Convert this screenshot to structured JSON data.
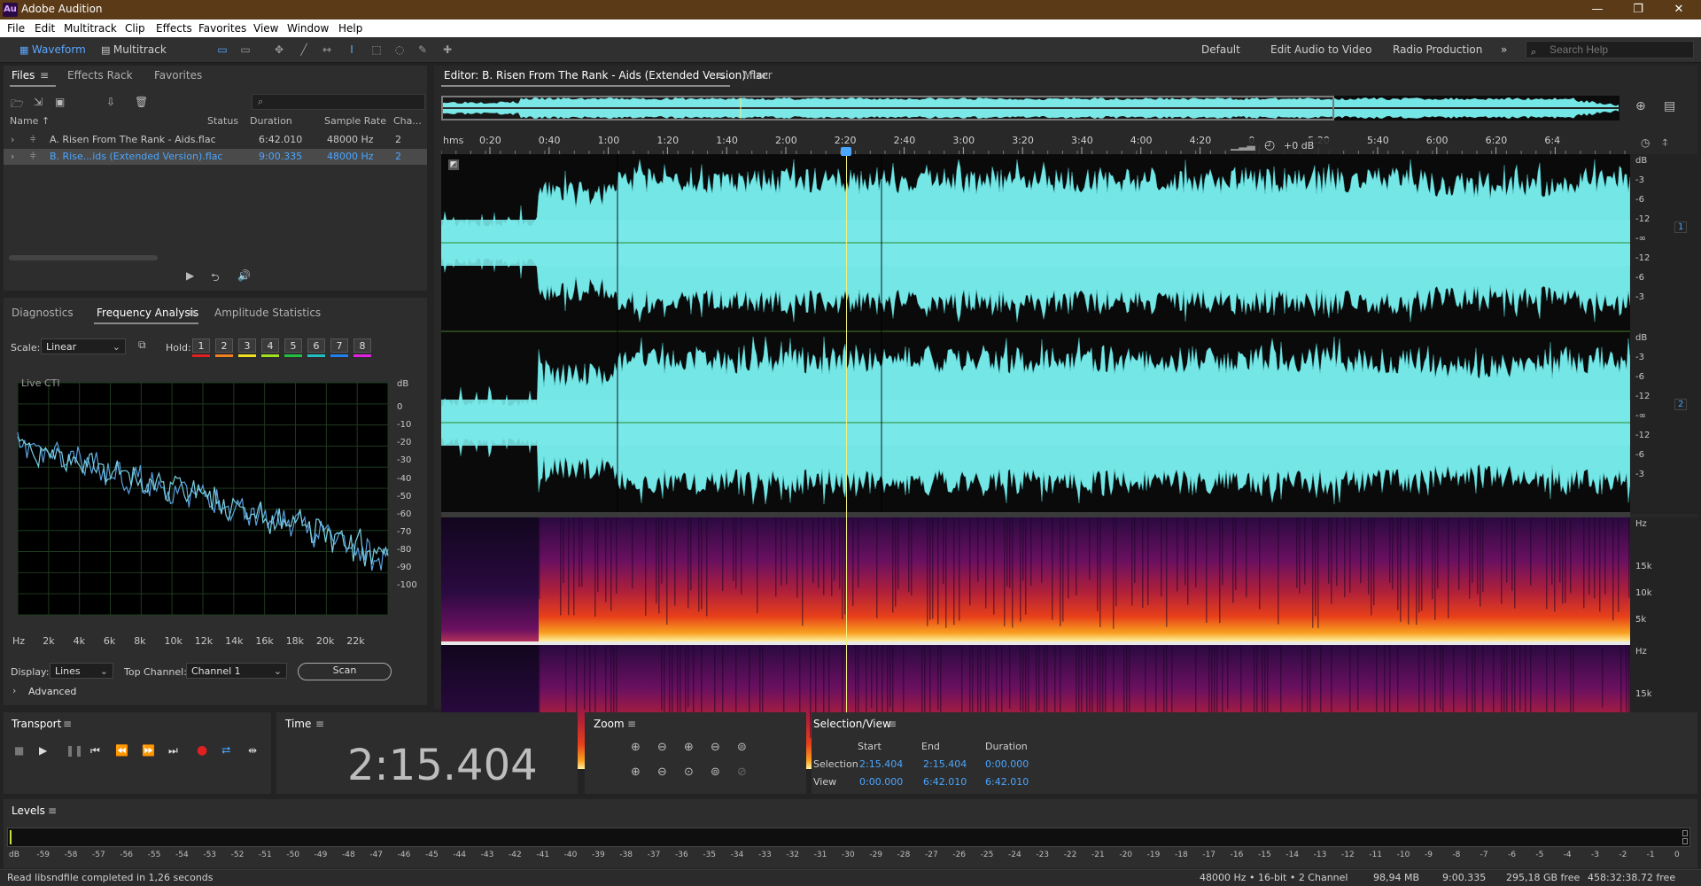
{
  "app": {
    "title": "Adobe Audition",
    "logo": "Au"
  },
  "menu": [
    "File",
    "Edit",
    "Multitrack",
    "Clip",
    "Effects",
    "Favorites",
    "View",
    "Window",
    "Help"
  ],
  "toolbar": {
    "modes": [
      {
        "label": "Waveform",
        "active": true
      },
      {
        "label": "Multitrack",
        "active": false
      }
    ],
    "workspaces": [
      "Default",
      "Edit Audio to Video",
      "Radio Production"
    ],
    "overflow": "»",
    "search_placeholder": "Search Help"
  },
  "files_panel": {
    "tabs": [
      "Files",
      "Effects Rack",
      "Favorites"
    ],
    "search_icon": "⌕",
    "columns": [
      "Name ↑",
      "Status",
      "Duration",
      "Sample Rate",
      "Cha..."
    ],
    "rows": [
      {
        "name": "A. Risen From The Rank - Aids.flac",
        "status": "",
        "duration": "6:42.010",
        "rate": "48000 Hz",
        "ch": "2",
        "selected": false
      },
      {
        "name": "B. Rise...ids (Extended Version).flac",
        "status": "",
        "duration": "9:00.335",
        "rate": "48000 Hz",
        "ch": "2",
        "selected": true
      }
    ]
  },
  "analysis_panel": {
    "tabs": [
      "Diagnostics",
      "Frequency Analysis",
      "Amplitude Statistics"
    ],
    "scale_label": "Scale:",
    "scale_value": "Linear",
    "hold_label": "Hold:",
    "holds": [
      {
        "n": "1",
        "color": "#e02020"
      },
      {
        "n": "2",
        "color": "#f08020"
      },
      {
        "n": "3",
        "color": "#f0e020"
      },
      {
        "n": "4",
        "color": "#a0e020"
      },
      {
        "n": "5",
        "color": "#20c040"
      },
      {
        "n": "6",
        "color": "#20c0c0"
      },
      {
        "n": "7",
        "color": "#2080f0"
      },
      {
        "n": "8",
        "color": "#e020e0"
      }
    ],
    "plot_label": "Live CTI",
    "db_ticks": [
      "dB",
      "0",
      "-10",
      "-20",
      "-30",
      "-40",
      "-50",
      "-60",
      "-70",
      "-80",
      "-90",
      "-100"
    ],
    "freq_ticks": [
      "Hz",
      "2k",
      "4k",
      "6k",
      "8k",
      "10k",
      "12k",
      "14k",
      "16k",
      "18k",
      "20k",
      "22k"
    ],
    "display_label": "Display:",
    "display_value": "Lines",
    "top_channel_label": "Top Channel:",
    "top_channel_value": "Channel 1",
    "scan_label": "Scan",
    "advanced_label": "Advanced"
  },
  "editor": {
    "tab_label": "Editor: B. Risen From The Rank - Aids (Extended Version).flac",
    "mixer_label": "Mixer",
    "ruler_unit": "hms",
    "ruler": [
      "0:20",
      "0:40",
      "1:00",
      "1:20",
      "1:40",
      "2:00",
      "2:20",
      "2:40",
      "3:00",
      "3:20",
      "3:40",
      "4:00",
      "4:20",
      "0",
      "5:20",
      "5:40",
      "6:00",
      "6:20",
      "6:4"
    ],
    "hud_gain": "+0 dB",
    "db_ticks_ch": [
      "dB",
      "-3",
      "-6",
      "-12",
      "-∞",
      "-12",
      "-6",
      "-3"
    ],
    "channels": [
      "1",
      "2"
    ],
    "spec_ticks": [
      "Hz",
      "15k",
      "10k",
      "5k"
    ],
    "colors": {
      "waveform": "#74e6e6",
      "playhead": "#f0f080"
    }
  },
  "transport": {
    "title": "Transport"
  },
  "time_panel": {
    "title": "Time",
    "value": "2:15.404"
  },
  "zoom_panel": {
    "title": "Zoom"
  },
  "selection_view": {
    "title": "Selection/View",
    "headers": [
      "Start",
      "End",
      "Duration"
    ],
    "rows": [
      {
        "label": "Selection",
        "start": "2:15.404",
        "end": "2:15.404",
        "duration": "0:00.000"
      },
      {
        "label": "View",
        "start": "0:00.000",
        "end": "6:42.010",
        "duration": "6:42.010"
      }
    ]
  },
  "levels": {
    "title": "Levels",
    "ticks": [
      "dB",
      "-59",
      "-58",
      "-57",
      "-56",
      "-55",
      "-54",
      "-53",
      "-52",
      "-51",
      "-50",
      "-49",
      "-48",
      "-47",
      "-46",
      "-45",
      "-44",
      "-43",
      "-42",
      "-41",
      "-40",
      "-39",
      "-38",
      "-37",
      "-36",
      "-35",
      "-34",
      "-33",
      "-32",
      "-31",
      "-30",
      "-29",
      "-28",
      "-27",
      "-26",
      "-25",
      "-24",
      "-23",
      "-22",
      "-21",
      "-20",
      "-19",
      "-18",
      "-17",
      "-16",
      "-15",
      "-14",
      "-13",
      "-12",
      "-11",
      "-10",
      "-9",
      "-8",
      "-7",
      "-6",
      "-5",
      "-4",
      "-3",
      "-2",
      "-1",
      "0"
    ]
  },
  "status": {
    "message": "Read libsndfile completed in 1,26 seconds",
    "format": "48000 Hz • 16-bit • 2 Channel",
    "size": "98,94 MB",
    "duration": "9:00.335",
    "free": "295,18 GB free",
    "free_time": "458:32:38.72 free"
  }
}
